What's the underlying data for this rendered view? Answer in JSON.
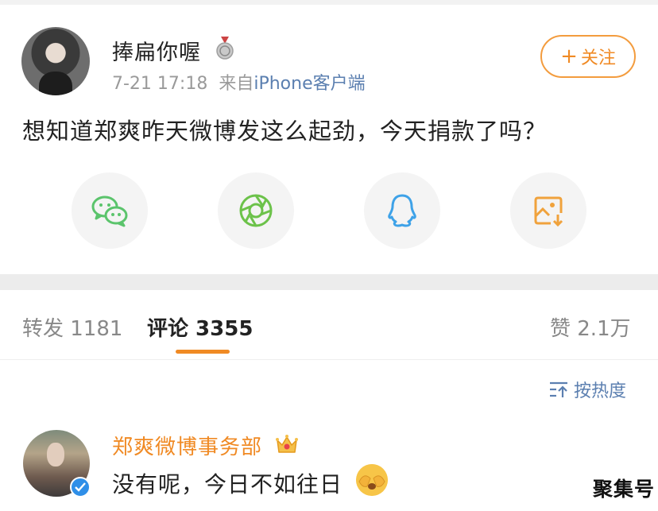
{
  "post": {
    "author": "捧扁你喔",
    "date": "7-21 17:18",
    "source_prefix": "来自",
    "source_app": "iPhone客户端",
    "follow_label": "关注",
    "follow_icon": "plus-icon",
    "text": "想知道郑爽昨天微博发这么起劲，今天捐款了吗？"
  },
  "share_buttons": [
    {
      "icon": "wechat-icon",
      "color": "#5bc46c"
    },
    {
      "icon": "moments-icon",
      "color": "#6cc24a"
    },
    {
      "icon": "qq-icon",
      "color": "#3ea2e8"
    },
    {
      "icon": "save-image-icon",
      "color": "#f0a23c"
    }
  ],
  "tabs": {
    "repost": "转发 1181",
    "comments": "评论 3355",
    "likes": "赞 2.1万"
  },
  "sort": {
    "label": "按热度",
    "icon": "sort-icon"
  },
  "comment": {
    "author": "郑爽微博事务部",
    "text": "没有呢，今日不如往日",
    "badge_icon": "crown-icon",
    "emoji": "cover-face-emoji",
    "verified_icon": "verified-icon"
  },
  "watermark": "聚集号",
  "colors": {
    "accent": "#f08a24",
    "link": "#5b7fb0",
    "verified": "#2f8fe8"
  }
}
